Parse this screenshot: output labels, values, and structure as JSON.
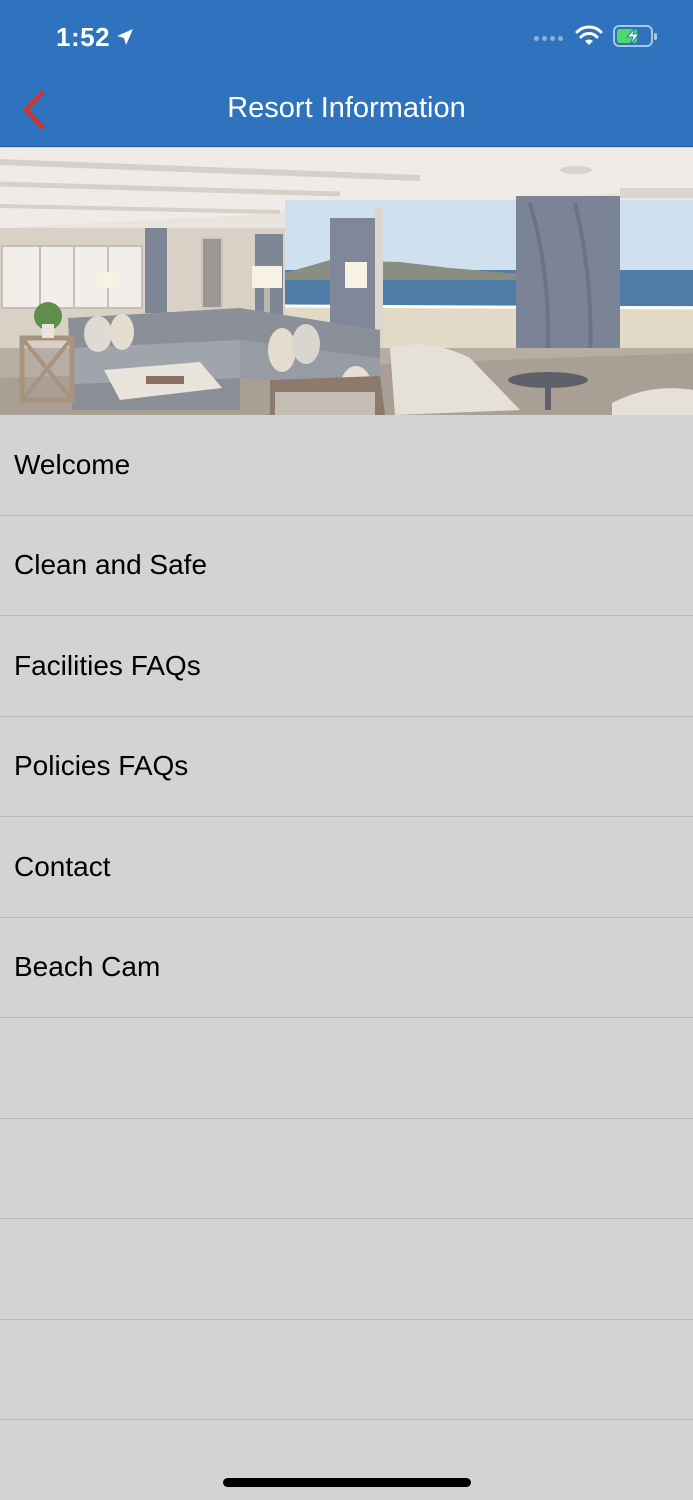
{
  "status_bar": {
    "time": "1:52",
    "location_icon": "location-arrow-icon",
    "wifi_icon": "wifi-icon",
    "battery_icon": "battery-charging-icon"
  },
  "header": {
    "title": "Resort Information",
    "back_icon": "chevron-left-icon",
    "background_color": "#2f72bd",
    "back_color": "#d0342c"
  },
  "hero": {
    "image": "resort-living-room-ocean-view-photo"
  },
  "menu": {
    "items": [
      {
        "label": "Welcome"
      },
      {
        "label": "Clean and Safe"
      },
      {
        "label": "Facilities FAQs"
      },
      {
        "label": "Policies FAQs"
      },
      {
        "label": "Contact"
      },
      {
        "label": "Beach Cam"
      }
    ]
  }
}
